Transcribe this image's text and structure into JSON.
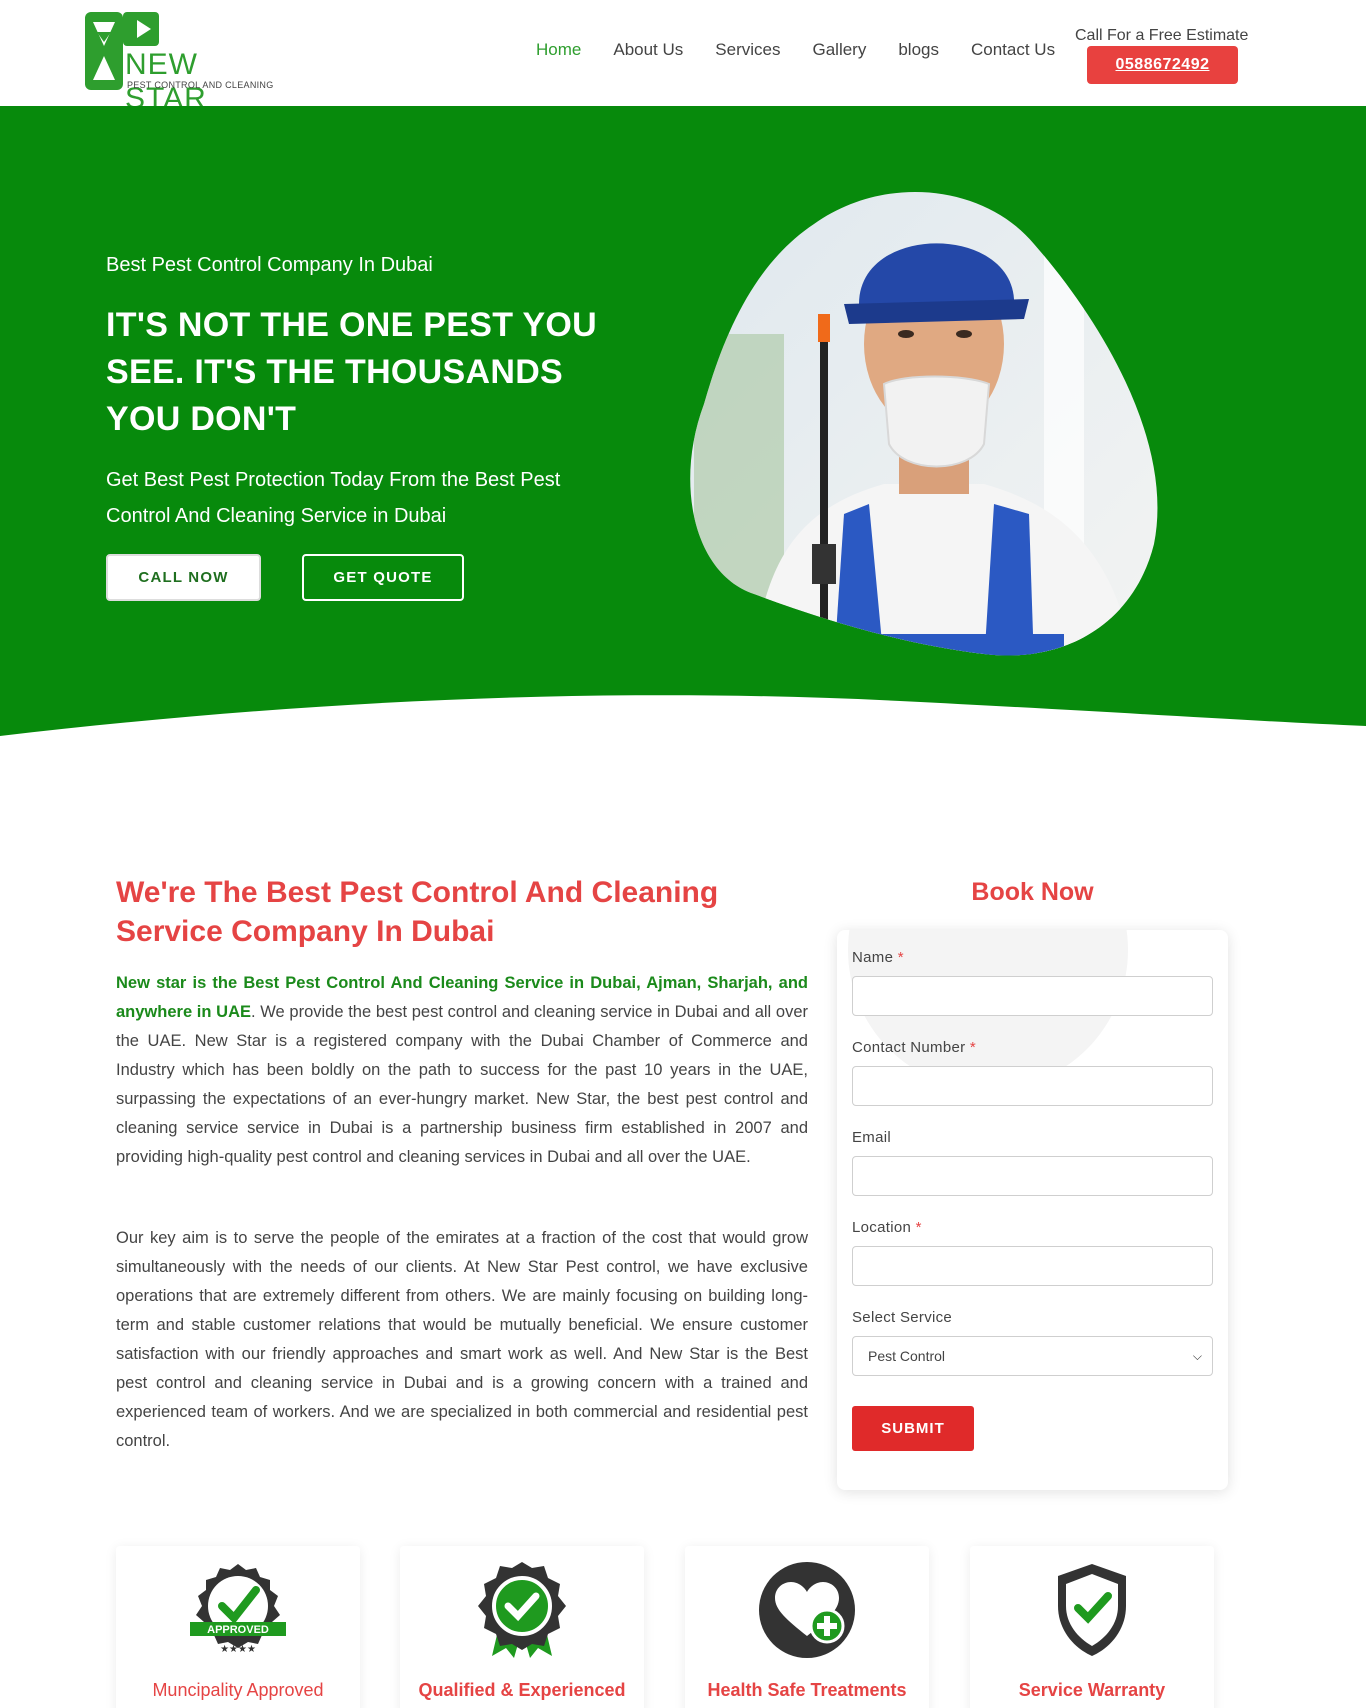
{
  "brand": {
    "name": "NEW STAR",
    "tagline": "PEST CONTROL AND CLEANING",
    "green": "#2e9e2e"
  },
  "nav": {
    "items": [
      {
        "label": "Home",
        "active": true
      },
      {
        "label": "About Us",
        "active": false
      },
      {
        "label": "Services",
        "active": false
      },
      {
        "label": "Gallery",
        "active": false
      },
      {
        "label": "blogs",
        "active": false
      },
      {
        "label": "Contact Us",
        "active": false
      }
    ],
    "estimate_label": "Call For a Free Estimate",
    "phone": "0588672492"
  },
  "hero": {
    "kicker": "Best Pest Control Company In Dubai",
    "title": "IT'S NOT THE ONE PEST YOU SEE. IT'S THE THOUSANDS YOU DON'T",
    "text": "Get Best Pest Protection Today From the Best Pest Control And  Cleaning  Service in Dubai",
    "call_label": "CALL NOW",
    "quote_label": "GET QUOTE",
    "bg_color": "#078a0c",
    "photo": "smiling pest control technician with sprayer"
  },
  "about": {
    "title": "We're The Best Pest Control And Cleaning Service Company In Dubai",
    "p1_lead": "New star is the Best Pest Control And Cleaning Service in Dubai, Ajman, Sharjah, and anywhere in UAE",
    "p1_rest": ". We provide the best pest control and cleaning service in Dubai and all over the UAE. New Star is a registered company with the Dubai Chamber of Commerce and Industry which has been boldly on the path to success for the past 10 years in the UAE, surpassing the expectations of an ever-hungry market. New Star, the best pest control and cleaning service service in Dubai is a partnership business firm established in 2007 and providing high-quality pest control and cleaning services in Dubai and all over the UAE.",
    "p2": " Our key aim is to serve the people of the emirates at a fraction of the cost that would grow simultaneously with the needs of our clients. At New Star Pest control, we have exclusive operations that are extremely different from others. We are mainly focusing on building long-term and stable customer relations that would be mutually beneficial. We ensure customer satisfaction with our friendly approaches and smart work as well. And New Star is the Best pest control and cleaning service in Dubai and is a growing concern with a trained and experienced team of workers. And we are specialized in both commercial and residential pest control."
  },
  "booking": {
    "title": "Book Now",
    "fields": {
      "name": {
        "label": "Name",
        "required_mark": "*",
        "value": ""
      },
      "contact": {
        "label": "Contact Number",
        "required_mark": "*",
        "value": ""
      },
      "email": {
        "label": "Email",
        "value": ""
      },
      "location": {
        "label": "Location",
        "required_mark": "*",
        "value": ""
      },
      "service": {
        "label": "Select Service",
        "value": "Pest Control"
      }
    },
    "submit_label": "SUBMIT",
    "accent": "#e02a2a"
  },
  "features": [
    {
      "label": "Muncipality Approved",
      "icon": "approved-badge-icon",
      "badge_text": "APPROVED"
    },
    {
      "label": "Qualified & Experienced",
      "icon": "award-ribbon-icon"
    },
    {
      "label": "Health Safe Treatments",
      "icon": "heart-plus-icon"
    },
    {
      "label": "Service Warranty",
      "icon": "shield-check-icon"
    }
  ]
}
